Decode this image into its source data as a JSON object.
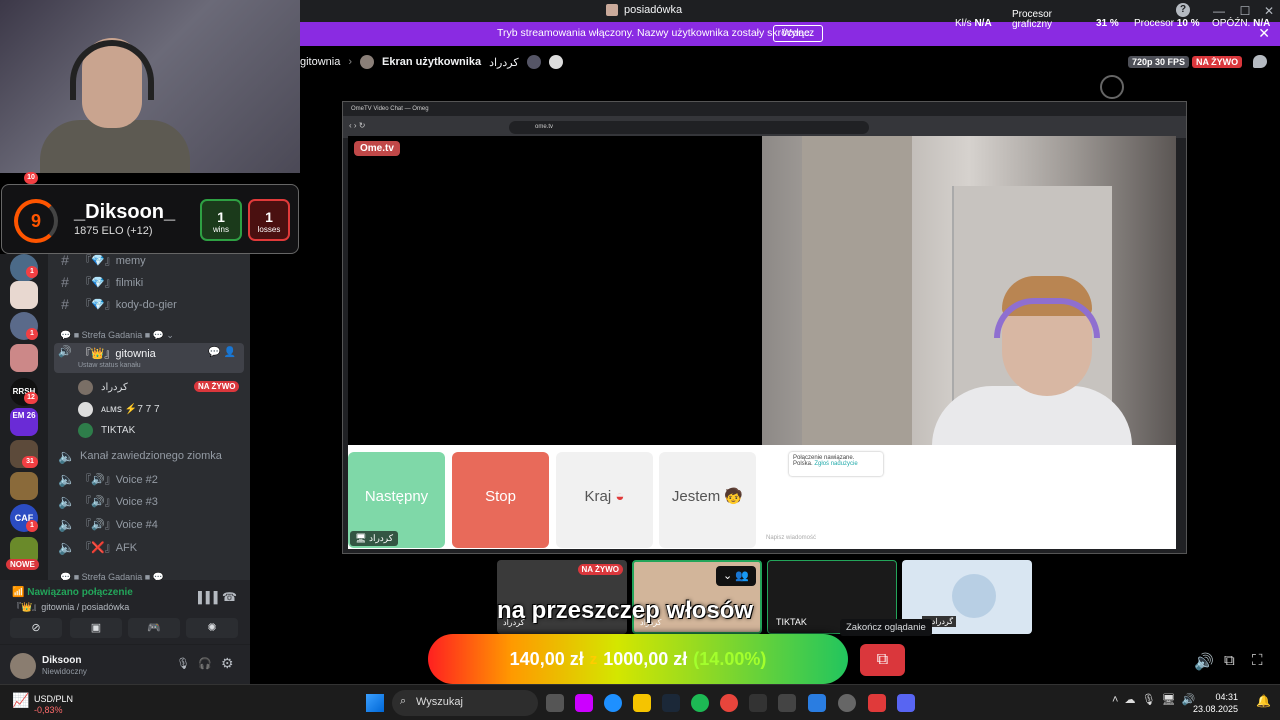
{
  "window": {
    "title": "posiadówka"
  },
  "banner": {
    "message": "Tryb streamowania włączony. Nazwy użytkownika zostały skrócone.",
    "disable_button": "Wyłącz",
    "stats": {
      "kbs_label": "Kl/s",
      "kbs_value": "N/A",
      "gpu_label_1": "Procesor",
      "gpu_label_2": "graficzny",
      "gpu_value": "31 %",
      "cpu_label": "Procesor",
      "cpu_value": "10 %",
      "delay_label": "OPÓŹN.",
      "delay_value": "N/A"
    }
  },
  "call_header": {
    "channel": "gitownia",
    "screen_label": "Ekran użytkownika",
    "screen_user": "کردراد",
    "quality": "720p 30 FPS",
    "live": "NA ŻYWO"
  },
  "elo_card": {
    "level": "9",
    "name": "_Diksoon_",
    "elo": "1875 ELO (+12)",
    "wins_value": "1",
    "wins_label": "wins",
    "losses_value": "1",
    "losses_label": "losses"
  },
  "servers": [
    {
      "badge": "1"
    },
    {
      "badge": ""
    },
    {
      "badge": "1"
    },
    {
      "badge": ""
    },
    {
      "badge": "12"
    },
    {
      "badge": ""
    },
    {
      "badge": "31"
    },
    {
      "badge": ""
    },
    {
      "badge": "1"
    },
    {
      "badge": ""
    }
  ],
  "server_labels": {
    "mh": "EM 26",
    "caf": "CAF",
    "nowe": "NOWE",
    "top_badge": "10"
  },
  "channels": {
    "text": [
      {
        "name": "『💎』memy"
      },
      {
        "name": "『💎』filmiki"
      },
      {
        "name": "『💎』kody-do-gier"
      }
    ],
    "category1": "Strefa Gadania",
    "active_voice": "『👑』gitownia",
    "active_status": "Ustaw status kanału",
    "users": [
      {
        "name": "کردراد",
        "live": "NA ŻYWO"
      },
      {
        "name": "ᴀʟᴍꜱ ⚡7 7 7",
        "live": ""
      },
      {
        "name": "TIKTAK",
        "live": ""
      }
    ],
    "voice": [
      {
        "name": "Kanał zawiedzionego ziomka"
      },
      {
        "name": "『🔊』Voice #2"
      },
      {
        "name": "『🔊』Voice #3"
      },
      {
        "name": "『🔊』Voice #4"
      },
      {
        "name": "『❌』AFK"
      }
    ],
    "category2": "Strefa Gadania"
  },
  "voice_panel": {
    "status": "Nawiązano połączenie",
    "channel": "『👑』gitownia / posiadówka"
  },
  "user_panel": {
    "name": "Diksoon",
    "status": "Niewidoczny"
  },
  "browser": {
    "tab_title": "OmeTV Video Chat — Omeg",
    "url": "ome.tv",
    "logo": "Ome.tv",
    "buttons": {
      "next": "Następny",
      "stop": "Stop",
      "country": "Kraj",
      "me": "Jestem"
    },
    "user_tag": "کردراد",
    "connected": "Połączenie nawiązane.",
    "country_line": "Polska.",
    "report": "Zgłoś nadużycie",
    "chat_placeholder": "Napisz wiadomość"
  },
  "tiles": [
    {
      "name": "کردراد",
      "live": "NA ŻYWO"
    },
    {
      "name": "کردراد"
    },
    {
      "name": "TIKTAK"
    },
    {
      "name": "...گردراد"
    }
  ],
  "caption": "na przeszczep włosów",
  "tooltip": "Zakończ oglądanie",
  "donation": {
    "current": "140,00 zł",
    "sep": "z",
    "goal": "1000,00 zł",
    "percent": "(14.00%)",
    "progress": 0.14
  },
  "taskbar": {
    "ticker": "USD/PLN",
    "ticker_change": "-0,83%",
    "search": "Wyszukaj",
    "time": "04:31",
    "date": "23.08.2025"
  }
}
